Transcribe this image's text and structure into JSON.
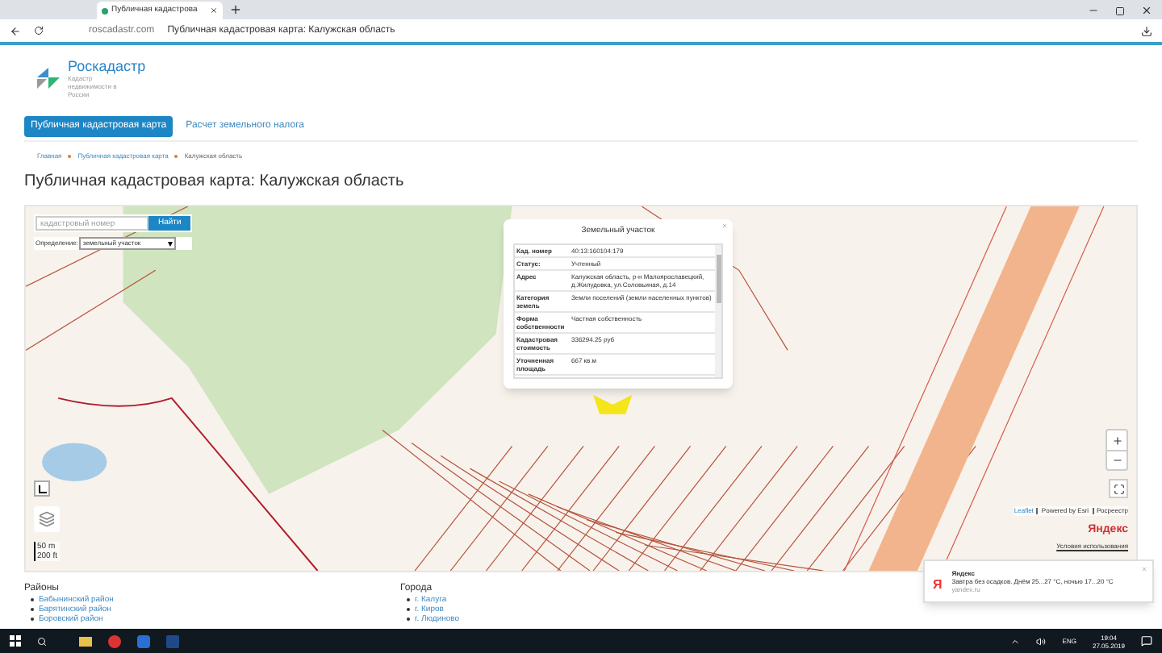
{
  "browser": {
    "tab_title": "Публичная кадастрова",
    "url": "roscadastr.com",
    "page_title": "Публичная кадастровая карта: Калужская область"
  },
  "logo": {
    "name": "Роскадастр",
    "tagline": "Кадастр недвижимости в России"
  },
  "nav": [
    {
      "label": "Публичная кадастровая карта",
      "selected": true
    },
    {
      "label": "Расчет земельного налога",
      "selected": false
    }
  ],
  "breadcrumbs": [
    "Главная",
    "Публичная кадастровая карта",
    "Калужская область"
  ],
  "heading": "Публичная кадастровая карта: Калужская область",
  "map": {
    "search": {
      "placeholder": "кадастровый номер",
      "button": "Найти"
    },
    "mode_label": "Определение:",
    "mode_value": "земельный участок",
    "scale": [
      "50 m",
      "200 ft"
    ],
    "attribution": [
      "Leaflet",
      "Powered by Esri",
      "Росреестр"
    ],
    "provider": "Яндекс",
    "terms": "Условия использования",
    "popup": {
      "title": "Земельный участок",
      "rows": [
        {
          "label": "Кад. номер",
          "value": "40:13:160104:179"
        },
        {
          "label": "Статус:",
          "value": "Учтенный"
        },
        {
          "label": "Адрес",
          "value": "Калужская область, р-н Малоярославецкий, д.Жилудовка, ул.Соловьиная, д.14"
        },
        {
          "label": "Категория земель",
          "value": "Земли поселений (земли населенных пунктов)"
        },
        {
          "label": "Форма собственности",
          "value": "Частная собственность"
        },
        {
          "label": "Кадастровая стоимость",
          "value": "336294.25 руб"
        },
        {
          "label": "Уточненная площадь",
          "value": "667 кв.м"
        }
      ]
    }
  },
  "footer": [
    {
      "title": "Районы",
      "items": [
        "Бабынинский район",
        "Барятинский район",
        "Боровский район"
      ]
    },
    {
      "title": "Города",
      "items": [
        "г. Калуга",
        "г. Киров",
        "г. Людиново"
      ]
    }
  ],
  "notification": {
    "icon": "Я",
    "title": "Яндекс",
    "text": "Завтра без осадков. Днём 25...27 °C, ночью 17...20 °C",
    "source": "yandex.ru"
  },
  "taskbar": {
    "language": "ENG",
    "time": "19:04",
    "date": "27.05.2019"
  }
}
